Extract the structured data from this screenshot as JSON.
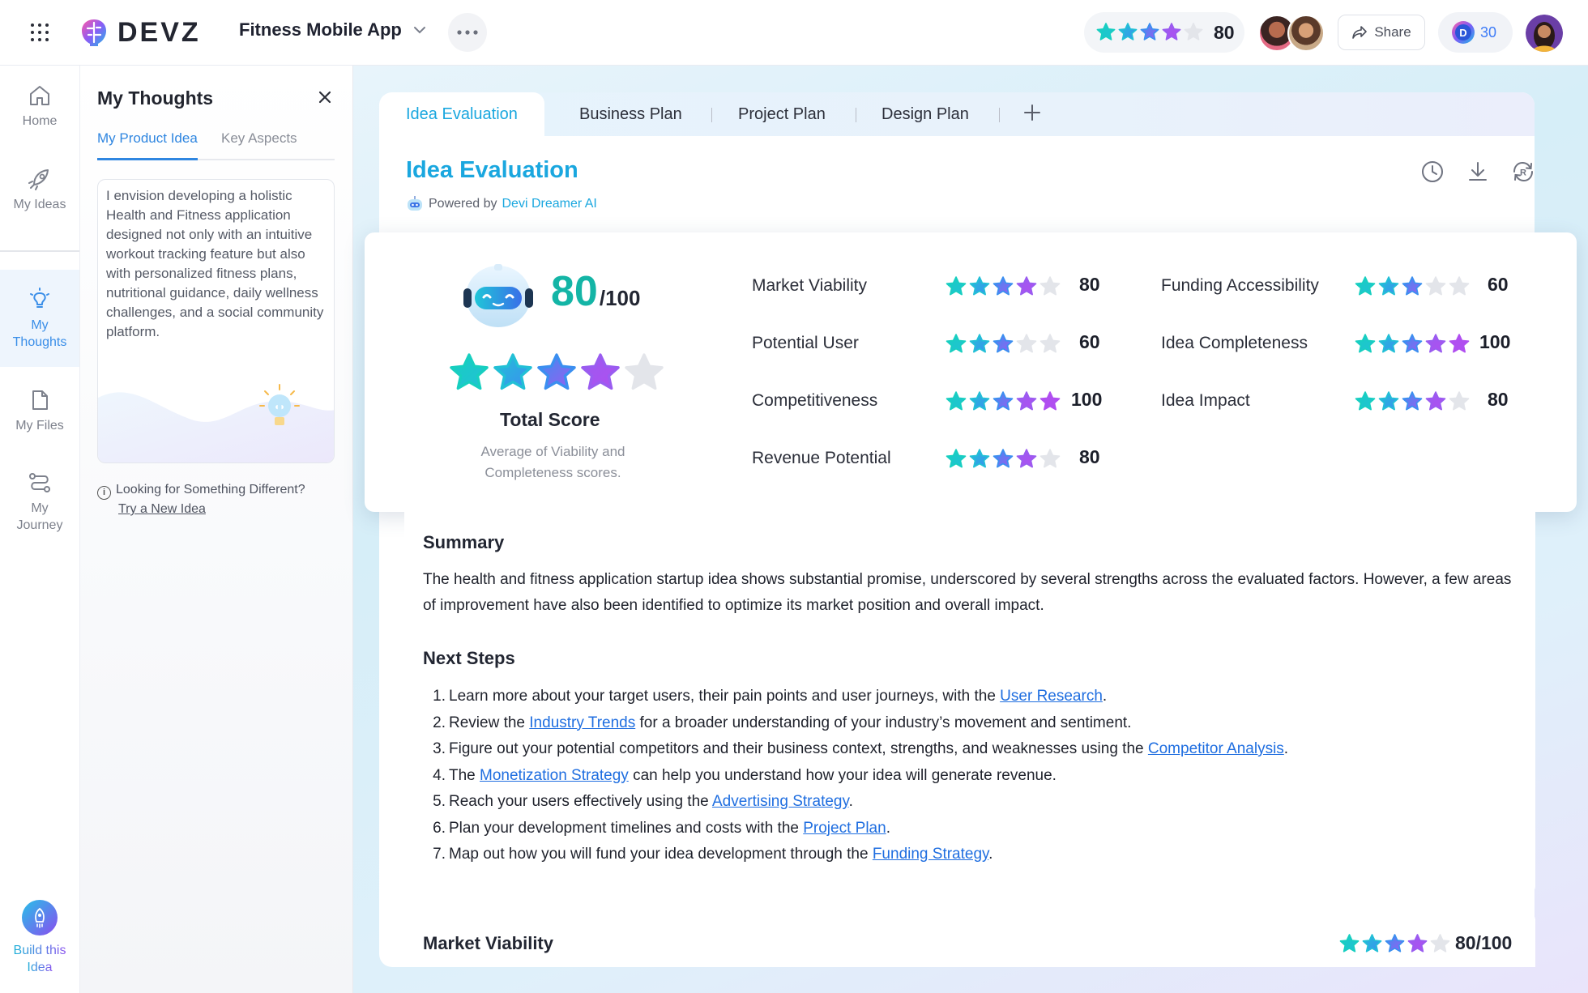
{
  "topbar": {
    "brand": "DEVZ",
    "project_name": "Fitness Mobile App",
    "score": "80",
    "share_label": "Share",
    "credits": "30",
    "credits_letter": "D"
  },
  "nav": {
    "home": "Home",
    "my_ideas": "My Ideas",
    "my_thoughts_1": "My",
    "my_thoughts_2": "Thoughts",
    "my_files": "My Files",
    "my_journey_1": "My",
    "my_journey_2": "Journey",
    "build_1": "Build this",
    "build_2": "Idea"
  },
  "thoughts": {
    "title": "My Thoughts",
    "tabs": [
      "My Product Idea",
      "Key Aspects"
    ],
    "idea_text": "I envision developing a holistic Health and Fitness application designed not only with an intuitive workout tracking feature but also with personalized fitness plans, nutritional guidance, daily wellness challenges, and a social community platform.",
    "looking": "Looking for Something Different?",
    "try_link": "Try a New Idea"
  },
  "tabs": [
    "Idea Evaluation",
    "Business Plan",
    "Project Plan",
    "Design Plan"
  ],
  "evaluation": {
    "title": "Idea Evaluation",
    "powered_by": "Powered by",
    "powered_brand": "Devi Dreamer AI",
    "total_score": "80",
    "total_max": "/100",
    "total_rating": 4,
    "total_label": "Total Score",
    "total_sub": "Average of Viability and Completeness scores.",
    "metrics": [
      {
        "label": "Market Viability",
        "value": "80",
        "rating": 4
      },
      {
        "label": "Potential User",
        "value": "60",
        "rating": 3
      },
      {
        "label": "Competitiveness",
        "value": "100",
        "rating": 5
      },
      {
        "label": "Revenue Potential",
        "value": "80",
        "rating": 4
      },
      {
        "label": "Funding Accessibility",
        "value": "60",
        "rating": 3
      },
      {
        "label": "Idea Completeness",
        "value": "100",
        "rating": 5
      },
      {
        "label": "Idea Impact",
        "value": "80",
        "rating": 4
      }
    ]
  },
  "summary": {
    "heading": "Summary",
    "text": "The health and fitness application startup idea shows substantial promise, underscored by several strengths across the evaluated factors. However, a few areas of improvement have also been identified to optimize its market position and overall impact."
  },
  "next_steps": {
    "heading": "Next Steps",
    "items": [
      {
        "num": "1.",
        "pre": "Learn more about your target users, their pain points and user journeys, with the ",
        "link": "User Research",
        "post": "."
      },
      {
        "num": "2.",
        "pre": "Review the ",
        "link": "Industry Trends",
        "post": " for a broader understanding of your industry’s movement and sentiment."
      },
      {
        "num": "3.",
        "pre": "Figure out your potential competitors and their business context, strengths, and weaknesses using the ",
        "link": "Competitor Analysis",
        "post": "."
      },
      {
        "num": "4.",
        "pre": "The ",
        "link": "Monetization Strategy",
        "post": " can help you understand how your idea will generate revenue."
      },
      {
        "num": "5.",
        "pre": "Reach your users effectively using the ",
        "link": "Advertising Strategy",
        "post": "."
      },
      {
        "num": "6.",
        "pre": "Plan your development timelines and costs with the ",
        "link": "Project Plan",
        "post": "."
      },
      {
        "num": "7.",
        "pre": "Map out how you will fund your idea development through the ",
        "link": "Funding Strategy",
        "post": "."
      }
    ]
  },
  "market_viability": {
    "title": "Market Viability",
    "score": "80/100",
    "rating": 4
  },
  "colors": {
    "accent": "#1aa7df",
    "score_teal": "#14b5a6",
    "link": "#1f6ee0",
    "star_colors": [
      "#17cfc0",
      "#22c0d6",
      "#3b8ff0",
      "#9a5cf0",
      "#b04ef0"
    ],
    "star_empty": "#e3e5ea"
  }
}
